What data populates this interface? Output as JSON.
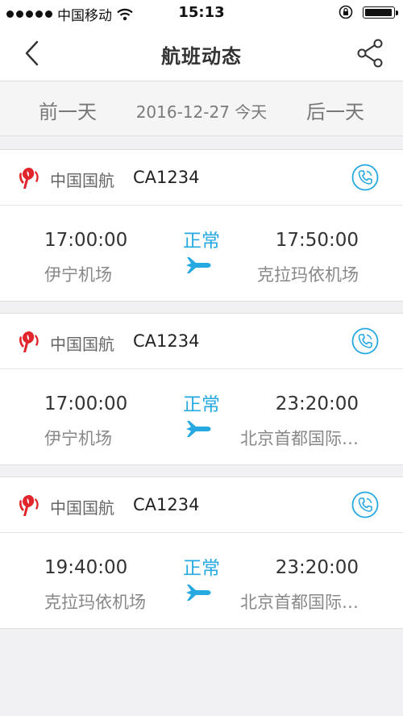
{
  "status_bar": {
    "carrier": "中国移动",
    "time": "15:13"
  },
  "nav": {
    "title": "航班动态"
  },
  "date_bar": {
    "prev": "前一天",
    "current": "2016-12-27 今天",
    "next": "后一天"
  },
  "flights": [
    {
      "airline": "中国国航",
      "flight_no": "CA1234",
      "status": "正常",
      "dep_time": "17:00:00",
      "dep_airport": "伊宁机场",
      "arr_time": "17:50:00",
      "arr_airport": "克拉玛依机场"
    },
    {
      "airline": "中国国航",
      "flight_no": "CA1234",
      "status": "正常",
      "dep_time": "17:00:00",
      "dep_airport": "伊宁机场",
      "arr_time": "23:20:00",
      "arr_airport": "北京首都国际…"
    },
    {
      "airline": "中国国航",
      "flight_no": "CA1234",
      "status": "正常",
      "dep_time": "19:40:00",
      "dep_airport": "克拉玛依机场",
      "arr_time": "23:20:00",
      "arr_airport": "北京首都国际…"
    }
  ],
  "colors": {
    "accent": "#26a9e0",
    "airline_red": "#e0262c"
  },
  "icons": {
    "back": "chevron-left-icon",
    "share": "share-icon",
    "phone": "phone-icon",
    "plane": "plane-icon",
    "airline_logo": "air-china-logo-icon"
  }
}
